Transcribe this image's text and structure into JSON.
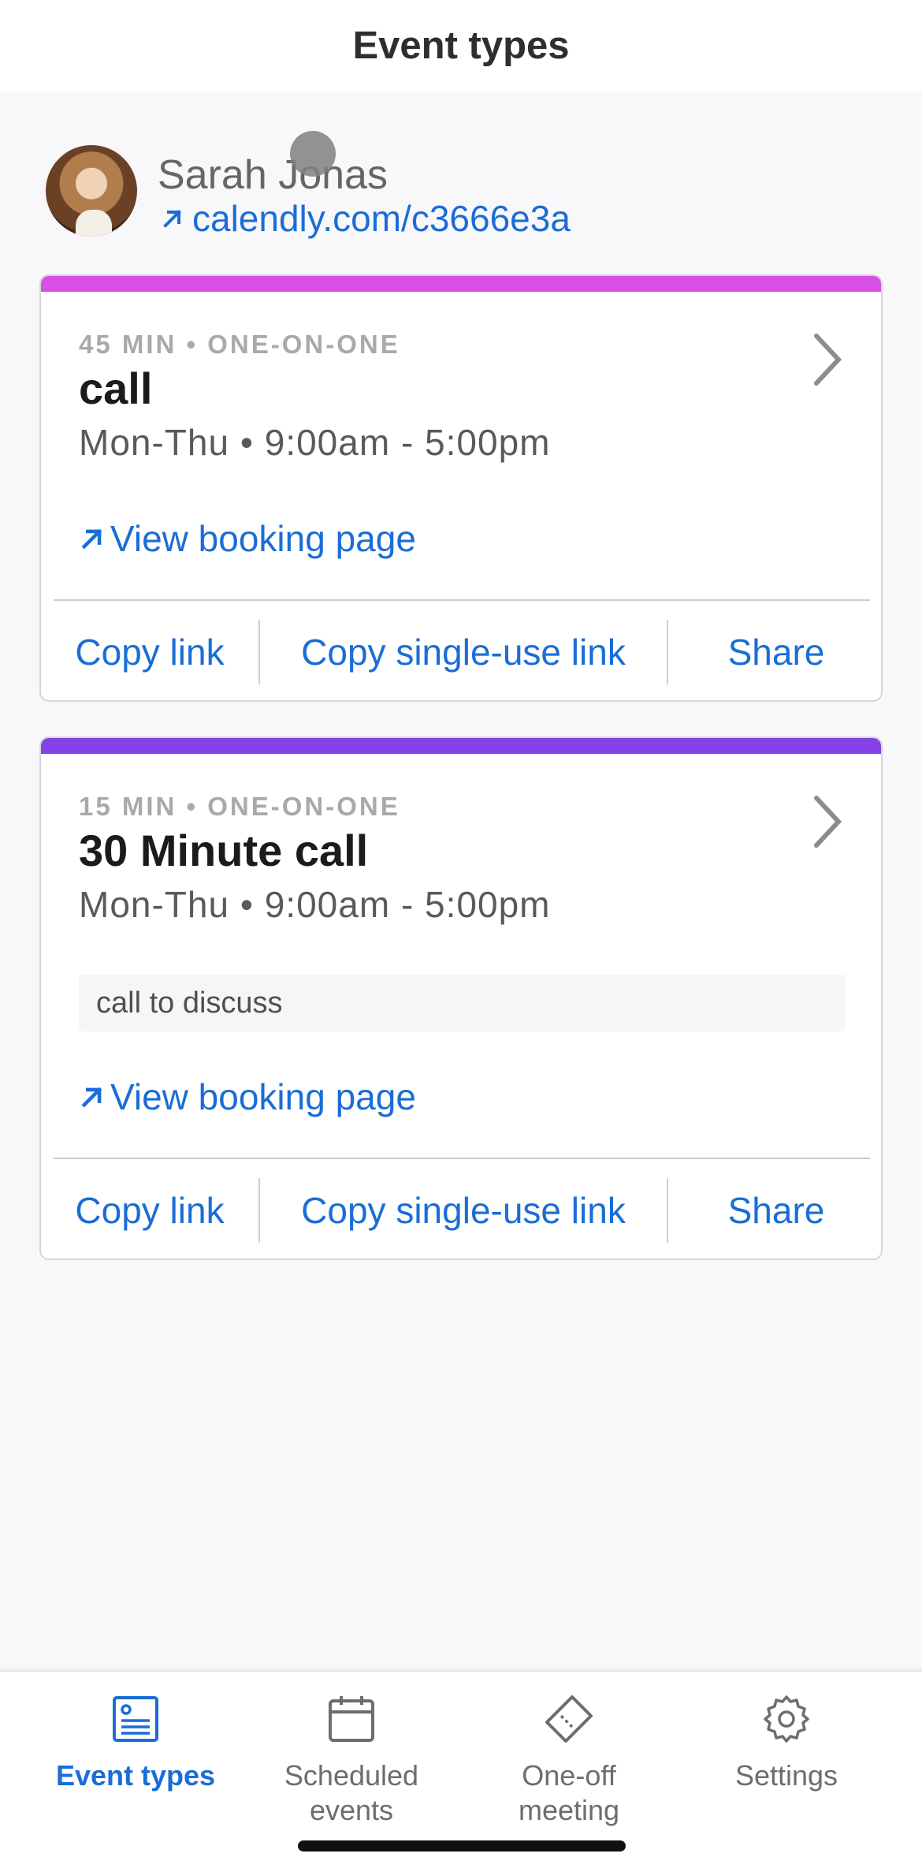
{
  "header": {
    "title": "Event types"
  },
  "profile": {
    "name": "Sarah Jonas",
    "link": "calendly.com/c3666e3a"
  },
  "events": [
    {
      "meta": "45 MIN • ONE-ON-ONE",
      "title": "call",
      "schedule": "Mon-Thu • 9:00am - 5:00pm",
      "description": "",
      "color": "#d64fe6",
      "view_label": "View booking page",
      "copy_link_label": "Copy link",
      "copy_single_label": "Copy single-use link",
      "share_label": "Share"
    },
    {
      "meta": "15 MIN • ONE-ON-ONE",
      "title": "30 Minute call",
      "schedule": "Mon-Thu • 9:00am - 5:00pm",
      "description": "call to discuss",
      "color": "#8341e6",
      "view_label": "View booking page",
      "copy_link_label": "Copy link",
      "copy_single_label": "Copy single-use link",
      "share_label": "Share"
    }
  ],
  "tabs": [
    {
      "label": "Event types",
      "icon": "event-types-icon",
      "active": true
    },
    {
      "label": "Scheduled\nevents",
      "icon": "calendar-icon",
      "active": false
    },
    {
      "label": "One-off\nmeeting",
      "icon": "ticket-icon",
      "active": false
    },
    {
      "label": "Settings",
      "icon": "gear-icon",
      "active": false
    }
  ],
  "colors": {
    "accent": "#1a6dd6",
    "card1_bar": "#d64fe6",
    "card2_bar": "#8341e6"
  }
}
